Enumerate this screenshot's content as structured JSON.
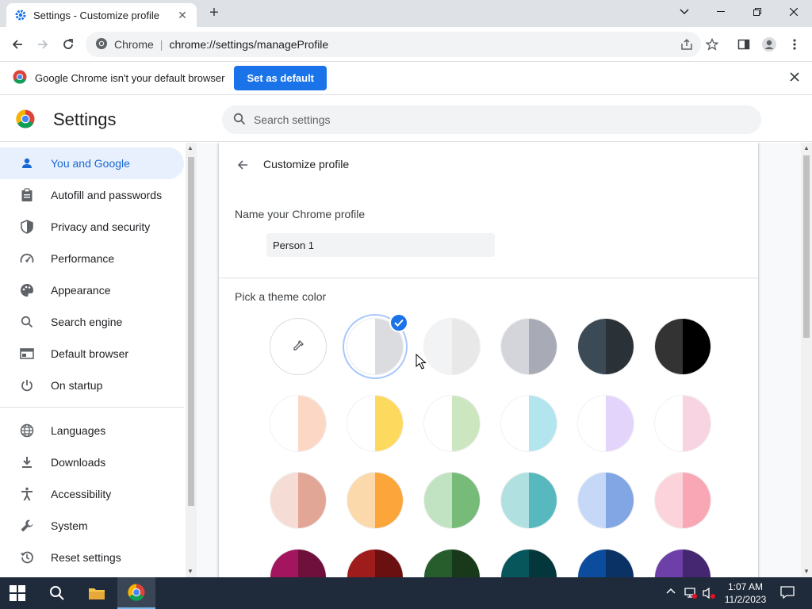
{
  "tab": {
    "title": "Settings - Customize profile",
    "close": "✕",
    "new": "+"
  },
  "window": {
    "minimize": "—",
    "maximize": "❐",
    "close": "✕",
    "tabsearch": "⌄"
  },
  "toolbar": {
    "chip": "Chrome",
    "sep": "|",
    "url": "chrome://settings/manageProfile"
  },
  "infobar": {
    "message": "Google Chrome isn't your default browser",
    "button": "Set as default",
    "close": "✕"
  },
  "settings": {
    "title": "Settings",
    "search_placeholder": "Search settings"
  },
  "sidebar": {
    "items": [
      {
        "label": "You and Google",
        "icon": "person-icon",
        "active": true
      },
      {
        "label": "Autofill and passwords",
        "icon": "clipboard-icon"
      },
      {
        "label": "Privacy and security",
        "icon": "shield-icon"
      },
      {
        "label": "Performance",
        "icon": "gauge-icon"
      },
      {
        "label": "Appearance",
        "icon": "palette-icon"
      },
      {
        "label": "Search engine",
        "icon": "search-icon"
      },
      {
        "label": "Default browser",
        "icon": "browser-icon"
      },
      {
        "label": "On startup",
        "icon": "power-icon"
      },
      {
        "label": "Languages",
        "icon": "globe-icon"
      },
      {
        "label": "Downloads",
        "icon": "download-icon"
      },
      {
        "label": "Accessibility",
        "icon": "accessibility-icon"
      },
      {
        "label": "System",
        "icon": "wrench-icon"
      },
      {
        "label": "Reset settings",
        "icon": "history-icon"
      }
    ]
  },
  "profile": {
    "title": "Customize profile",
    "name_label": "Name your Chrome profile",
    "name_value": "Person 1",
    "theme_label": "Pick a theme color",
    "colors": [
      [
        null,
        null
      ],
      [
        "#ffffff",
        "#dadce0"
      ],
      [
        "#f1f3f4",
        "#e8e8e8"
      ],
      [
        "#d3d5db",
        "#a8abb5"
      ],
      [
        "#3c4a55",
        "#2a3238"
      ],
      [
        "#333333",
        "#000000"
      ],
      [
        "#ffffff",
        "#fdd7c5"
      ],
      [
        "#ffffff",
        "#fdd95e"
      ],
      [
        "#ffffff",
        "#cce7c0"
      ],
      [
        "#ffffff",
        "#b3e5ee"
      ],
      [
        "#ffffff",
        "#e3d4fb"
      ],
      [
        "#ffffff",
        "#f8d4e3"
      ],
      [
        "#f5ddd5",
        "#e2a696"
      ],
      [
        "#fcd9ab",
        "#fba53a"
      ],
      [
        "#c2e3c2",
        "#77bb78"
      ],
      [
        "#b1e0e1",
        "#57b9bd"
      ],
      [
        "#c5d8f7",
        "#82a6e4"
      ],
      [
        "#fcd3da",
        "#f9a7b4"
      ],
      [
        "#a3155f",
        "#6f0f3b"
      ],
      [
        "#9e1c1c",
        "#6b1010"
      ],
      [
        "#275c2c",
        "#183a1b"
      ],
      [
        "#07565b",
        "#03373b"
      ],
      [
        "#0b4c9c",
        "#0a3264"
      ],
      [
        "#6d3fa8",
        "#442770"
      ]
    ],
    "selected_index": 1
  },
  "taskbar": {
    "time": "1:07 AM",
    "date": "11/2/2023"
  }
}
